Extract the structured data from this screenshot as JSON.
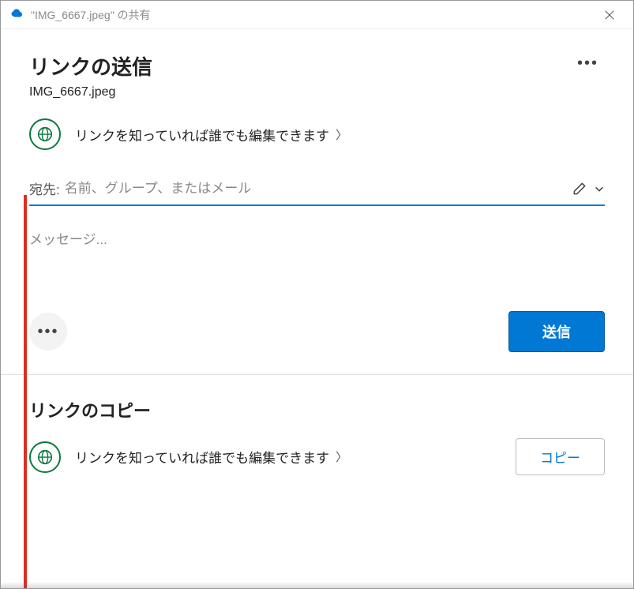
{
  "titlebar": {
    "text": "\"IMG_6667.jpeg\" の共有"
  },
  "header": {
    "title": "リンクの送信",
    "filename": "IMG_6667.jpeg"
  },
  "permission": {
    "text": "リンクを知っていれば誰でも編集できます"
  },
  "recipients": {
    "label": "宛先:",
    "placeholder": "名前、グループ、またはメール"
  },
  "message": {
    "placeholder": "メッセージ..."
  },
  "actions": {
    "send": "送信"
  },
  "copySection": {
    "title": "リンクのコピー",
    "permission": "リンクを知っていれば誰でも編集できます",
    "copyButton": "コピー"
  }
}
